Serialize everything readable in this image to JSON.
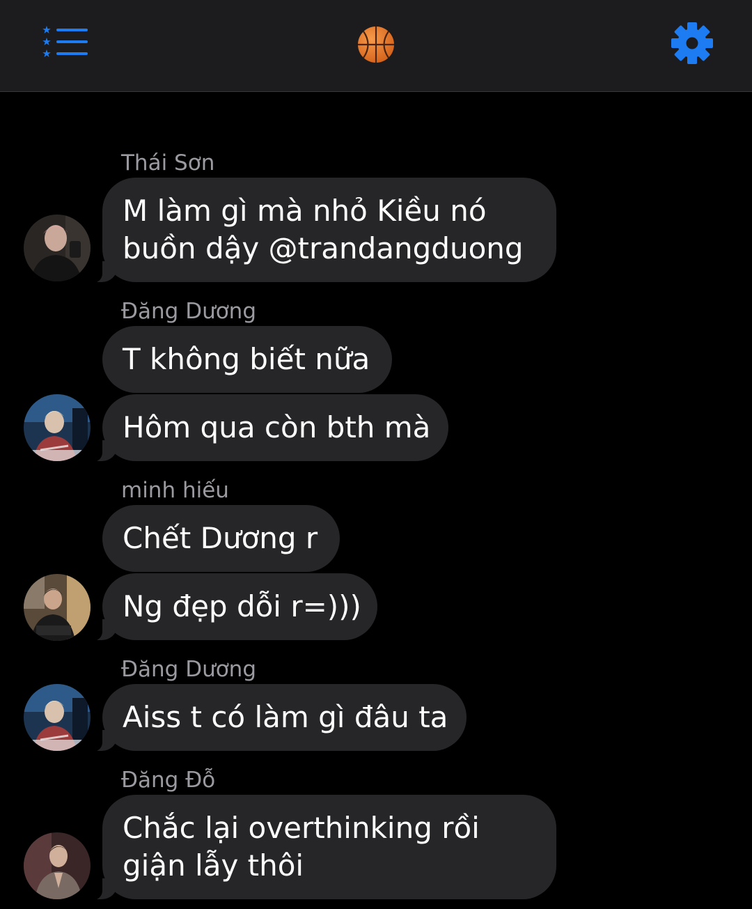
{
  "header": {
    "menu_icon": "list-star-icon",
    "center_icon": "basketball-emoji",
    "settings_icon": "gear-icon",
    "accent_color": "#1d7cf2"
  },
  "messages": [
    {
      "sender": "Thái Sơn",
      "text_lines": [
        "M làm gì mà nhỏ Kiều nó",
        "buồn dậy @trandangduong"
      ]
    },
    {
      "sender": "Đăng Dương",
      "text_lines": [
        "T không biết nữa"
      ]
    },
    {
      "text_lines": [
        "Hôm qua còn bth mà"
      ]
    },
    {
      "sender": "minh hiếu",
      "text_lines": [
        "Chết Dương r"
      ]
    },
    {
      "text_lines": [
        "Ng đẹp dỗi r=)))"
      ]
    },
    {
      "sender": "Đăng Dương",
      "text_lines": [
        "Aiss t có làm gì đâu ta"
      ]
    },
    {
      "sender": "Đăng Đỗ",
      "text_lines": [
        "Chắc lại overthinking rồi",
        "giận lẫy thôi"
      ]
    }
  ]
}
